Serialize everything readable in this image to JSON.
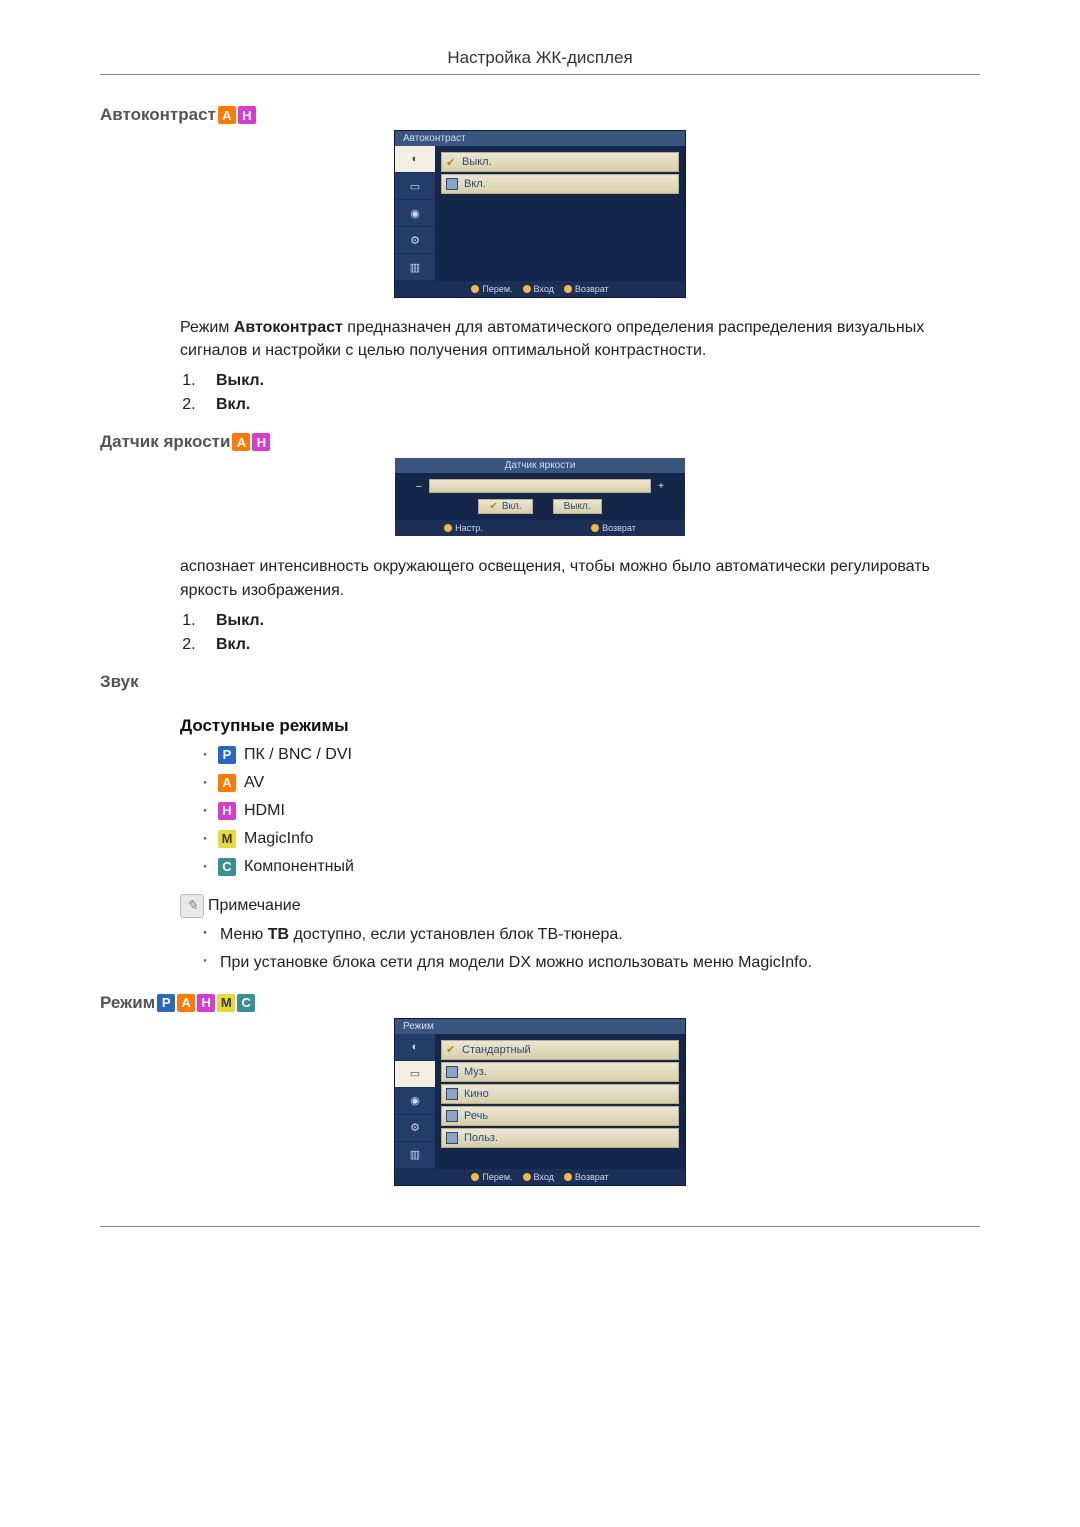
{
  "page_header": "Настройка ЖК-дисплея",
  "badges": {
    "P": "P",
    "A": "A",
    "H": "H",
    "M": "M",
    "C": "C"
  },
  "autocontrast": {
    "heading": "Автоконтраст",
    "osd": {
      "title": "Автоконтраст",
      "options": [
        {
          "label": "Выкл.",
          "selected": true
        },
        {
          "label": "Вкл."
        }
      ],
      "footer": {
        "move": "Перем.",
        "enter": "Вход",
        "return": "Возврат"
      }
    },
    "paragraph_prefix": "Режим ",
    "paragraph_bold": "Автоконтраст",
    "paragraph_suffix": " предназначен для автоматического определения распределения визуальных сигналов и настройки с целью получения оптимальной контрастности.",
    "list": [
      "Выкл.",
      "Вкл."
    ]
  },
  "brightness_sensor": {
    "heading": "Датчик яркости",
    "osd": {
      "title": "Датчик яркости",
      "on_label": "Вкл.",
      "off_label": "Выкл.",
      "footer": {
        "adjust": "Настр.",
        "return": "Возврат"
      }
    },
    "paragraph": "аспознает интенсивность окружающего освещения, чтобы можно было автоматически регулировать яркость изображения.",
    "list": [
      "Выкл.",
      "Вкл."
    ]
  },
  "sound": {
    "heading": "Звук",
    "available_heading": "Доступные режимы",
    "modes": [
      {
        "badge": "P",
        "label": "ПК / BNC / DVI"
      },
      {
        "badge": "A",
        "label": "AV"
      },
      {
        "badge": "H",
        "label": "HDMI"
      },
      {
        "badge": "M",
        "label": "MagicInfo"
      },
      {
        "badge": "C",
        "label": "Компонентный"
      }
    ],
    "note_label": "Примечание",
    "notes": [
      {
        "prefix": "Меню ",
        "bold": "ТВ",
        "suffix": " доступно, если установлен блок ТВ-тюнера."
      },
      {
        "prefix": "При установке блока сети для модели DX можно использовать меню MagicInfo.",
        "bold": "",
        "suffix": ""
      }
    ]
  },
  "mode": {
    "heading": "Режим ",
    "osd": {
      "title": "Режим",
      "options": [
        {
          "label": "Стандартный",
          "selected": true
        },
        {
          "label": "Муз."
        },
        {
          "label": "Кино"
        },
        {
          "label": "Речь"
        },
        {
          "label": "Польз."
        }
      ],
      "footer": {
        "move": "Перем.",
        "enter": "Вход",
        "return": "Возврат"
      }
    }
  }
}
